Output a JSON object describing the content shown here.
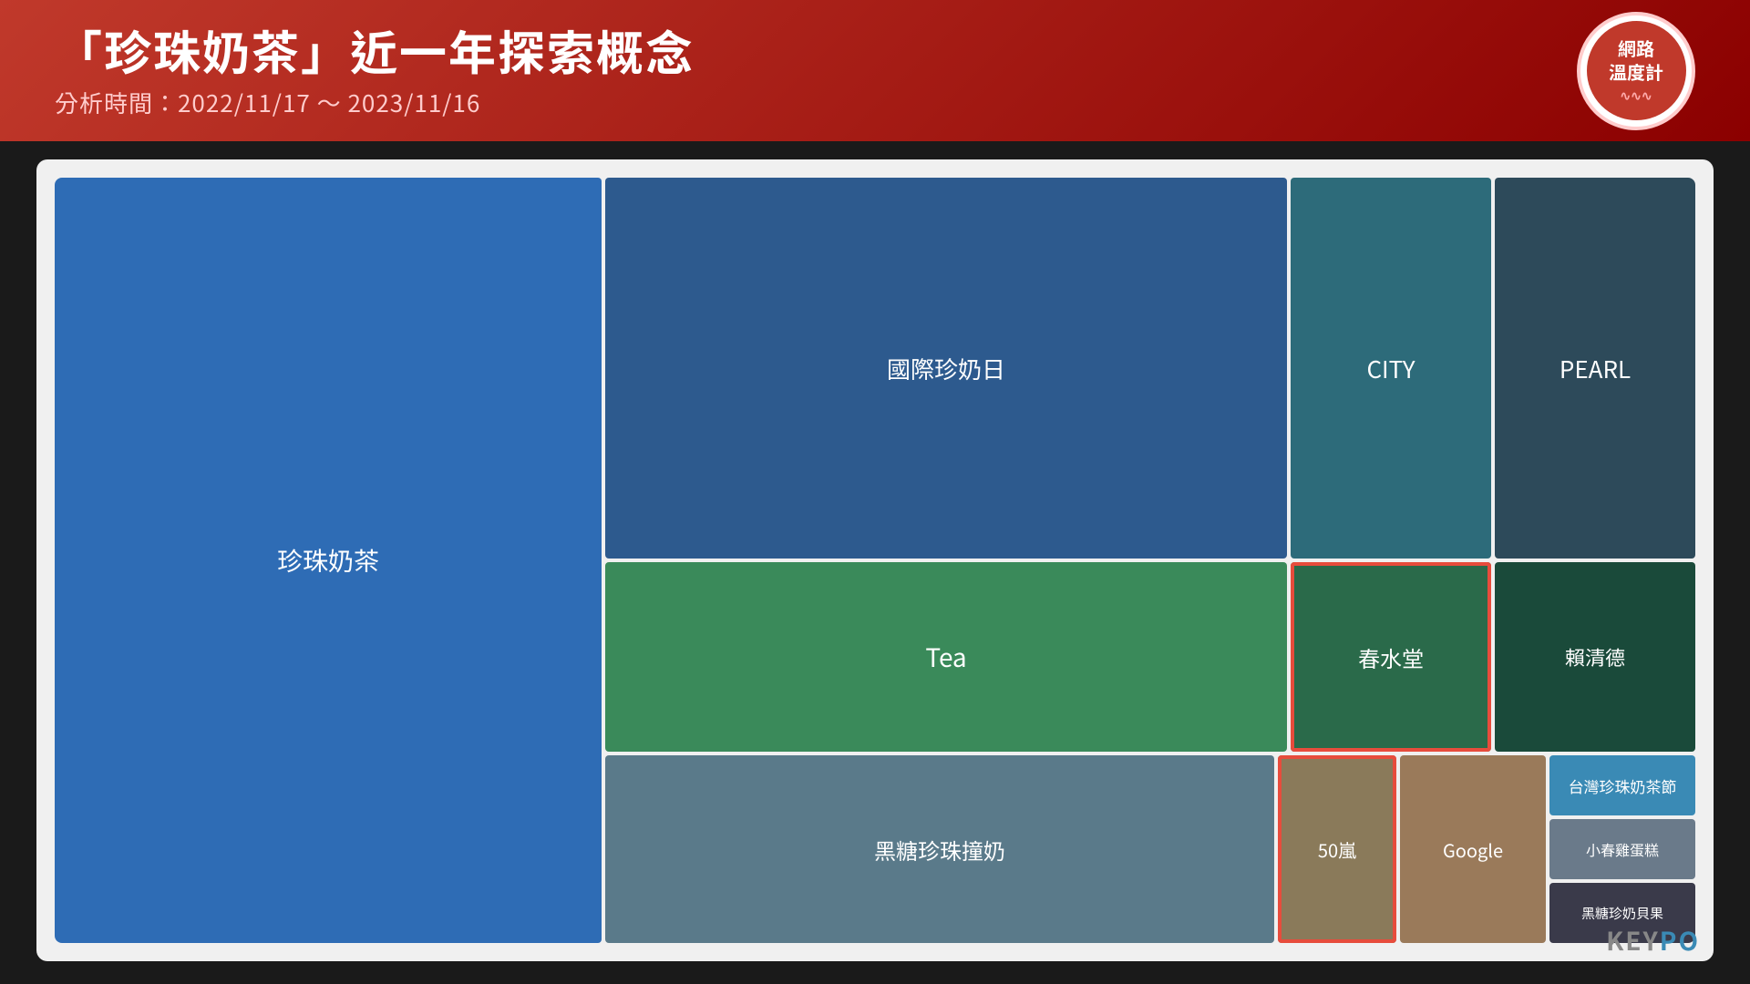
{
  "header": {
    "title": "「珍珠奶茶」近一年探索概念",
    "subtitle": "分析時間：2022/11/17 ～ 2023/11/16",
    "logo_line1": "網路",
    "logo_line2": "溫度計",
    "logo_wave": "∿∿∿"
  },
  "treemap": {
    "cells": [
      {
        "id": "zhenzhu",
        "label": "珍珠奶茶",
        "color": "#2e6cb5"
      },
      {
        "id": "guoji",
        "label": "國際珍奶日",
        "color": "#2d5a8e"
      },
      {
        "id": "city",
        "label": "CITY",
        "color": "#2d6b7a"
      },
      {
        "id": "pearl",
        "label": "PEARL",
        "color": "#2d4a5a"
      },
      {
        "id": "tea",
        "label": "Tea",
        "color": "#3a8a5a"
      },
      {
        "id": "chunshui",
        "label": "春水堂",
        "color": "#2a6a4a",
        "highlighted": true
      },
      {
        "id": "lai",
        "label": "賴清德",
        "color": "#1a4a3a"
      },
      {
        "id": "heitan",
        "label": "黑糖珍珠撞奶",
        "color": "#5a7a8a"
      },
      {
        "id": "50lan",
        "label": "50嵐",
        "color": "#8a7a5a",
        "highlighted": true
      },
      {
        "id": "google",
        "label": "Google",
        "color": "#9a7a5a"
      },
      {
        "id": "taiwan",
        "label": "台灣珍珠奶茶節",
        "color": "#3a8ab5"
      },
      {
        "id": "xiaochun",
        "label": "小春雞蛋糕",
        "color": "#6a7a8a"
      },
      {
        "id": "heitan2",
        "label": "黑糖珍奶貝果",
        "color": "#3a3a4a"
      }
    ]
  },
  "watermark": {
    "text_key": "KEY",
    "text_po": "P",
    "text_o": "O"
  }
}
